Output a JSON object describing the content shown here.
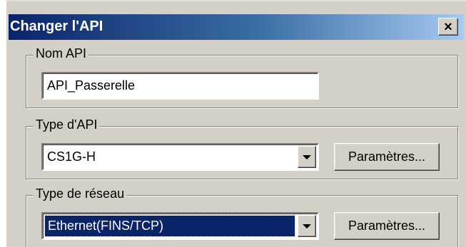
{
  "window": {
    "title": "Changer l'API",
    "close_glyph": "×",
    "close_icon": "close-icon"
  },
  "nom_api": {
    "label": "Nom API",
    "value": "API_Passerelle"
  },
  "type_api": {
    "label": "Type d'API",
    "selected": "CS1G-H",
    "button_label": "Paramètres..."
  },
  "type_reseau": {
    "label": "Type de réseau",
    "selected": "Ethernet(FINS/TCP)",
    "button_label": "Paramètres..."
  },
  "colors": {
    "title_gradient_start": "#0a246a",
    "title_gradient_end": "#a6caf0",
    "dialog_face": "#d4d0c8",
    "selection": "#0a246a"
  }
}
